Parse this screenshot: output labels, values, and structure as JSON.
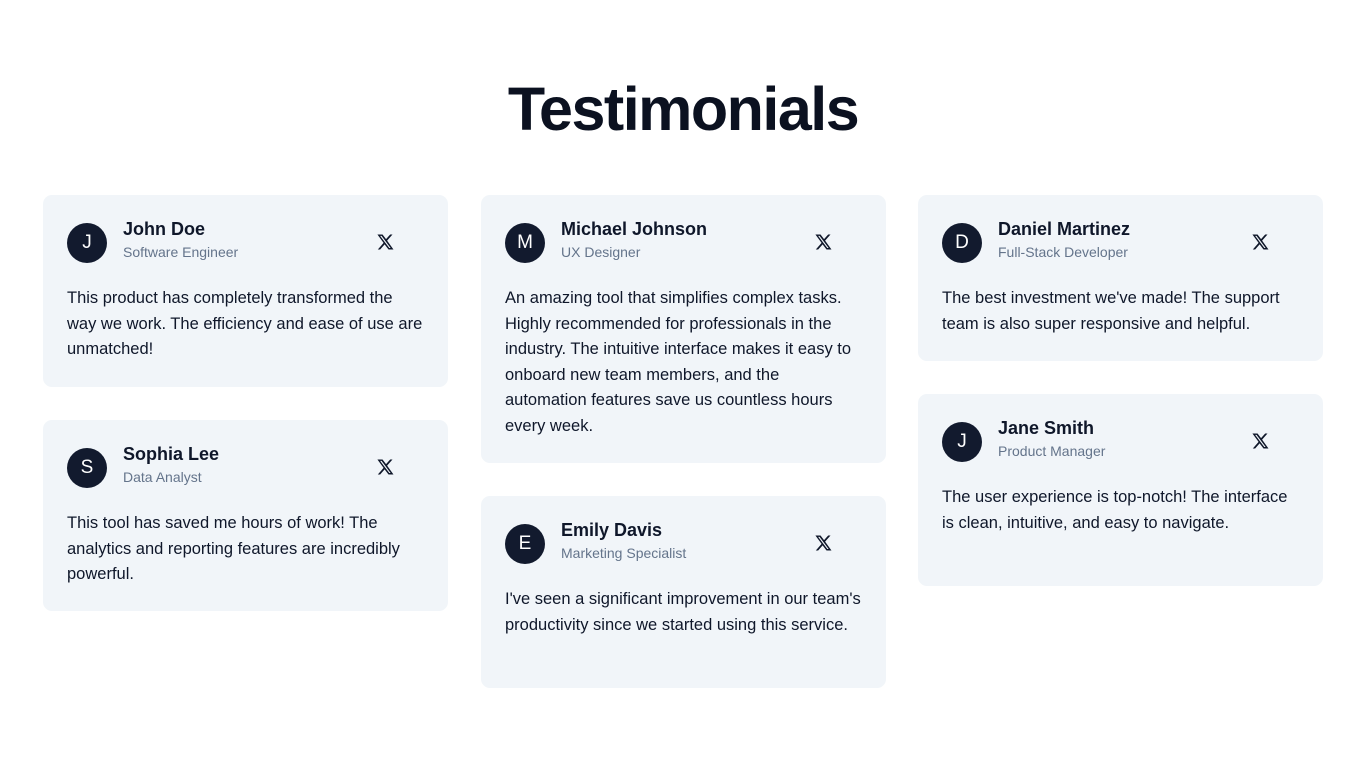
{
  "page": {
    "title": "Testimonials"
  },
  "colors": {
    "background": "#ffffff",
    "card_background": "#f1f5f9",
    "avatar_background": "#121a2e",
    "title_color": "#0b1120",
    "role_color": "#64748b"
  },
  "icons": {
    "social": "x-logo-icon"
  },
  "testimonials": [
    {
      "initial": "J",
      "name": "John Doe",
      "role": "Software Engineer",
      "quote": "This product has completely transformed the way we work. The efficiency and ease of use are unmatched!"
    },
    {
      "initial": "S",
      "name": "Sophia Lee",
      "role": "Data Analyst",
      "quote": "This tool has saved me hours of work! The analytics and reporting features are incredibly powerful."
    },
    {
      "initial": "M",
      "name": "Michael Johnson",
      "role": "UX Designer",
      "quote": "An amazing tool that simplifies complex tasks. Highly recommended for professionals in the industry. The intuitive interface makes it easy to onboard new team members, and the automation features save us countless hours every week."
    },
    {
      "initial": "E",
      "name": "Emily Davis",
      "role": "Marketing Specialist",
      "quote": "I've seen a significant improvement in our team's productivity since we started using this service."
    },
    {
      "initial": "D",
      "name": "Daniel Martinez",
      "role": "Full-Stack Developer",
      "quote": "The best investment we've made! The support team is also super responsive and helpful."
    },
    {
      "initial": "J",
      "name": "Jane Smith",
      "role": "Product Manager",
      "quote": "The user experience is top-notch! The interface is clean, intuitive, and easy to navigate."
    }
  ]
}
